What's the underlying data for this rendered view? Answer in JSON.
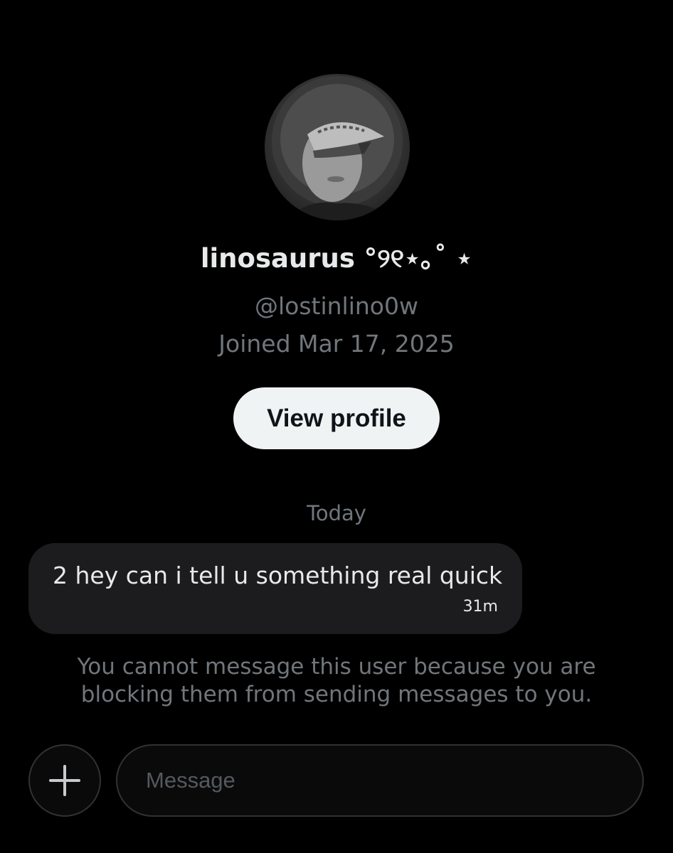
{
  "profile": {
    "display_name": "linosaurus °୨୧⋆｡˚ ⋆",
    "handle": "@lostinlino0w",
    "joined": "Joined Mar 17, 2025",
    "view_profile_label": "View profile"
  },
  "conversation": {
    "date_divider": "Today",
    "messages": [
      {
        "text": "2 hey can i tell u something real quick",
        "time": "31m"
      }
    ],
    "blocked_notice": "You cannot message this user because you are blocking them from sending messages to you."
  },
  "composer": {
    "placeholder": "Message",
    "add_icon": "plus-icon"
  },
  "colors": {
    "background": "#000000",
    "primary_text": "#e7e9ea",
    "secondary_text": "#71767b",
    "bubble_bg": "#1c1c1e",
    "button_bg": "#eff3f4",
    "border": "#2f3336"
  }
}
